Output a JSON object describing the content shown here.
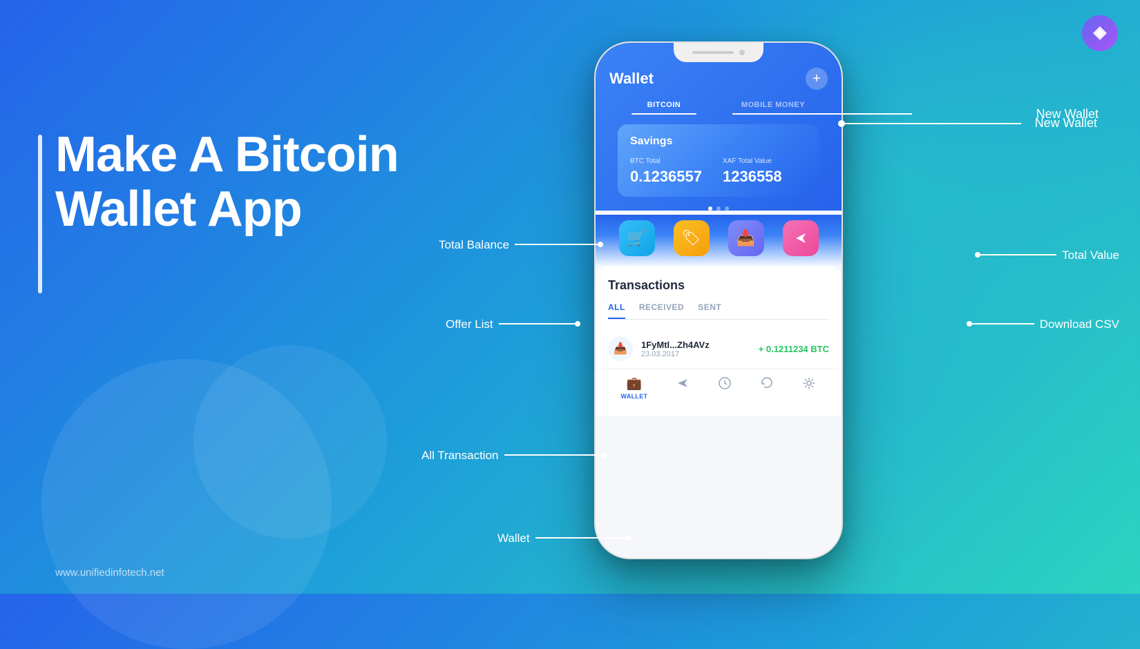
{
  "background": {
    "gradient_start": "#2563eb",
    "gradient_end": "#2dd4bf"
  },
  "logo": {
    "symbol": "⚡"
  },
  "left": {
    "title_line1": "Make A Bitcoin",
    "title_line2": "Wallet App",
    "footer": "www.unifiedinfotech.net"
  },
  "annotations": {
    "new_wallet": "New Wallet",
    "total_balance": "Total Balance",
    "total_value": "Total Value",
    "offer_list": "Offer List",
    "download_csv": "Download CSV",
    "all_transaction": "All Transaction",
    "wallet": "Wallet"
  },
  "phone": {
    "title": "Wallet",
    "plus_button": "+",
    "tabs": [
      {
        "label": "BITCOIN",
        "active": true
      },
      {
        "label": "MOBILE MONEY",
        "active": false
      }
    ],
    "savings_card": {
      "title": "Savings",
      "btc_label": "BTC Total",
      "btc_value": "0.1236557",
      "xaf_label": "XAF Total Value",
      "xaf_value": "1236558"
    },
    "action_buttons": [
      {
        "icon": "🛒",
        "color": "blue",
        "label": "offer"
      },
      {
        "icon": "🏷️",
        "color": "orange",
        "label": "tag"
      },
      {
        "icon": "📥",
        "color": "purple",
        "label": "download"
      },
      {
        "icon": "↗",
        "color": "pink",
        "label": "share"
      }
    ],
    "transactions": {
      "title": "Transactions",
      "tabs": [
        {
          "label": "ALL",
          "active": true
        },
        {
          "label": "RECEIVED",
          "active": false
        },
        {
          "label": "SENT",
          "active": false
        }
      ],
      "items": [
        {
          "address": "1FyMtl...Zh4AVz",
          "date": "23.03.2017",
          "amount": "+ 0.1211234 BTC"
        }
      ]
    },
    "bottom_nav": [
      {
        "icon": "💼",
        "label": "WALLET",
        "active": true
      },
      {
        "icon": "↗",
        "label": "",
        "active": false
      },
      {
        "icon": "⏱",
        "label": "",
        "active": false
      },
      {
        "icon": "↺",
        "label": "",
        "active": false
      },
      {
        "icon": "⚙",
        "label": "",
        "active": false
      }
    ]
  }
}
